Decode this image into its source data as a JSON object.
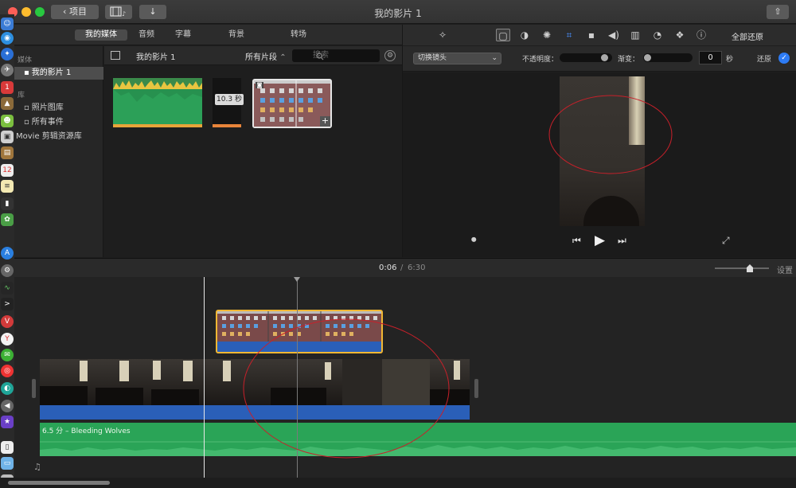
{
  "window": {
    "title": "我的影片 1"
  },
  "toolbar": {
    "back_label": "项目"
  },
  "media_tabs": [
    {
      "label": "我的媒体",
      "active": true
    },
    {
      "label": "音频",
      "active": false
    },
    {
      "label": "字幕",
      "active": false
    },
    {
      "label": "背景",
      "active": false
    },
    {
      "label": "转场",
      "active": false
    }
  ],
  "sidebar": {
    "section_project": "媒体",
    "project_item": "我的影片 1",
    "section_library": "库",
    "library_items": [
      "照片图库",
      "所有事件",
      "Movie 剪辑资源库"
    ]
  },
  "browser": {
    "title": "我的影片 1",
    "filter_label": "所有片段",
    "search_placeholder": "搜索",
    "clip2_badge": "10.3 秒"
  },
  "viewer": {
    "reset_all": "全部还原",
    "style_select": "切换镜头",
    "opacity_label": "不透明度：",
    "fade_label": "渐变：",
    "fade_value": "0",
    "seconds_unit": "秒",
    "reset_label": "还原"
  },
  "timeline": {
    "current_time": "0:06",
    "separator": "/",
    "total_time": "6:30",
    "settings_label": "设置",
    "audio_track_label": "6.5 分 – Bleeding Wolves"
  },
  "colors": {
    "accent": "#2d7bf4",
    "audio_green": "#2aa457",
    "clip_border": "#f2b733",
    "video_blue": "#2a5fb8",
    "annotation_red": "#c8202a"
  }
}
